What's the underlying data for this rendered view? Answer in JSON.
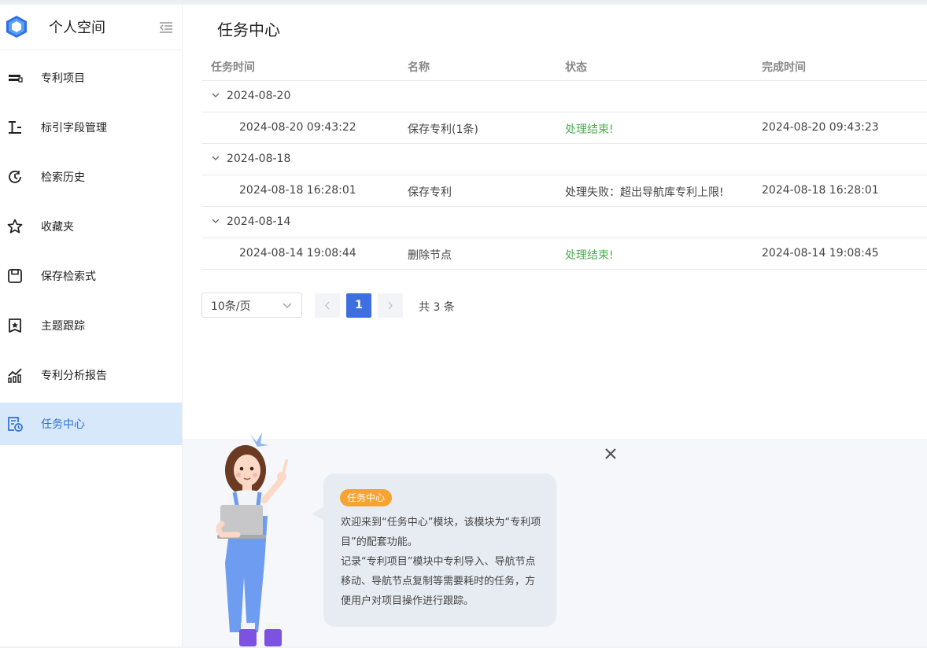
{
  "sidebar": {
    "title": "个人空间",
    "items": [
      {
        "label": "专利项目",
        "icon": "patent-project-icon"
      },
      {
        "label": "标引字段管理",
        "icon": "index-field-icon"
      },
      {
        "label": "检索历史",
        "icon": "history-icon"
      },
      {
        "label": "收藏夹",
        "icon": "star-icon"
      },
      {
        "label": "保存检索式",
        "icon": "save-icon"
      },
      {
        "label": "主题跟踪",
        "icon": "topic-track-icon"
      },
      {
        "label": "专利分析报告",
        "icon": "chart-report-icon"
      },
      {
        "label": "任务中心",
        "icon": "task-center-icon",
        "active": true
      }
    ]
  },
  "main": {
    "title": "任务中心",
    "columns": [
      "任务时间",
      "名称",
      "状态",
      "完成时间"
    ],
    "groups": [
      {
        "date": "2024-08-20",
        "rows": [
          {
            "time": "2024-08-20 09:43:22",
            "name": "保存专利(1条)",
            "status": "处理结束!",
            "status_type": "success",
            "finish": "2024-08-20 09:43:23"
          }
        ]
      },
      {
        "date": "2024-08-18",
        "rows": [
          {
            "time": "2024-08-18 16:28:01",
            "name": "保存专利",
            "status": "处理失败：超出导航库专利上限!",
            "status_type": "error",
            "finish": "2024-08-18 16:28:01"
          }
        ]
      },
      {
        "date": "2024-08-14",
        "rows": [
          {
            "time": "2024-08-14 19:08:44",
            "name": "删除节点",
            "status": "处理结束!",
            "status_type": "success",
            "finish": "2024-08-14 19:08:45"
          }
        ]
      }
    ],
    "pagination": {
      "page_size": "10条/页",
      "current_page": "1",
      "total": "共 3 条"
    }
  },
  "help": {
    "tag": "任务中心",
    "paragraphs": [
      "欢迎来到“任务中心”模块，该模块为“专利项目”的配套功能。",
      "记录“专利项目”模块中专利导入、导航节点移动、导航节点复制等需要耗时的任务，方便用户对项目操作进行跟踪。"
    ]
  },
  "colors": {
    "accent": "#3d6fe0",
    "active_bg": "#d7e8fb",
    "success": "#4caf50",
    "tag": "#f5a431"
  }
}
